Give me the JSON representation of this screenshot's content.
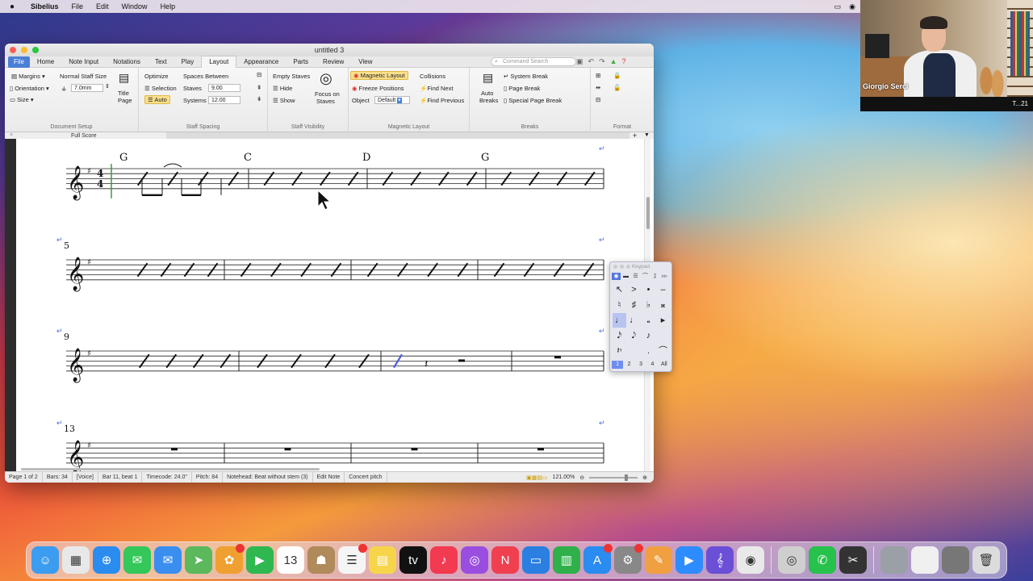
{
  "menubar": {
    "app": "Sibelius",
    "items": [
      "File",
      "Edit",
      "Window",
      "Help"
    ]
  },
  "window": {
    "title": "untitled 3"
  },
  "tabs": [
    "File",
    "Home",
    "Note Input",
    "Notations",
    "Text",
    "Play",
    "Layout",
    "Appearance",
    "Parts",
    "Review",
    "View"
  ],
  "active_tab": "Layout",
  "search_placeholder": "Command Search",
  "ribbon": {
    "doc_setup": {
      "margins": "Margins",
      "staff_size_label": "Normal Staff Size",
      "orientation": "Orientation",
      "staff_size_value": "7.0mm",
      "size": "Size",
      "title_page_1": "Title",
      "title_page_2": "Page",
      "group_label": "Document Setup"
    },
    "staff_spacing": {
      "optimize": "Optimize",
      "spaces_between": "Spaces Between",
      "selection": "Selection",
      "staves": "Staves",
      "staves_value": "9.00",
      "auto": "Auto",
      "systems": "Systems",
      "systems_value": "12.00",
      "group_label": "Staff Spacing"
    },
    "staff_visibility": {
      "empty_staves": "Empty Staves",
      "hide": "Hide",
      "show": "Show",
      "focus_1": "Focus on",
      "focus_2": "Staves",
      "group_label": "Staff Visibility"
    },
    "magnetic_layout": {
      "magnetic": "Magnetic Layout",
      "collisions": "Collisions",
      "freeze": "Freeze Positions",
      "find_next": "Find Next",
      "object": "Object",
      "object_value": "Default",
      "find_previous": "Find Previous",
      "group_label": "Magnetic Layout"
    },
    "breaks": {
      "auto_1": "Auto",
      "auto_2": "Breaks",
      "system_break": "System Break",
      "page_break": "Page Break",
      "special_page_break": "Special Page Break",
      "group_label": "Breaks"
    },
    "format": {
      "group_label": "Format"
    }
  },
  "subbar": {
    "full_score": "Full Score"
  },
  "score": {
    "systems": [
      {
        "bar_number": "",
        "chords": [
          "G",
          "C",
          "D",
          "G"
        ]
      },
      {
        "bar_number": "5"
      },
      {
        "bar_number": "9"
      },
      {
        "bar_number": "13"
      }
    ]
  },
  "status": {
    "page": "Page 1 of 2",
    "bars": "Bars: 34",
    "voice": "[Voice]",
    "position": "Bar 11, beat 1",
    "timecode": "Timecode: 24.0\"",
    "pitch": "Pitch: 84",
    "notehead": "Notehead: Beat without stem (3)",
    "mode": "Edit Note",
    "concert": "Concert pitch",
    "zoom": "121.00%"
  },
  "keypad": {
    "title": "Keypad",
    "modes": [
      "◉",
      "▬",
      "☰",
      "⌒",
      "⁒",
      "▹▹"
    ],
    "keys": [
      "↖",
      ">",
      "•",
      "–",
      "♮",
      "♯",
      "♭",
      "𝄪",
      "♩",
      "♩",
      "𝅝",
      "▸",
      "𝅘𝅥𝅯",
      "𝅘𝅥𝅮",
      "♪",
      " ",
      "𝄽𝄾",
      " ",
      ".",
      "⌒"
    ],
    "layouts": [
      "1",
      "2",
      "3",
      "4",
      "All"
    ]
  },
  "webcam": {
    "name": "Giorgio Serci",
    "strip_text": "T...21"
  },
  "dock": {
    "apps": [
      {
        "name": "finder",
        "color": "#3b9cf0",
        "glyph": "☺"
      },
      {
        "name": "launchpad",
        "color": "#e8e8e8",
        "glyph": "▦"
      },
      {
        "name": "safari",
        "color": "#2b8cf0",
        "glyph": "⊕"
      },
      {
        "name": "messages",
        "color": "#34c759",
        "glyph": "✉"
      },
      {
        "name": "mail",
        "color": "#3a8ef0",
        "glyph": "✉"
      },
      {
        "name": "maps",
        "color": "#5cb85c",
        "glyph": "➤"
      },
      {
        "name": "photos",
        "color": "#f0a030",
        "glyph": "✿"
      },
      {
        "name": "facetime",
        "color": "#2fb84f",
        "glyph": "▶"
      },
      {
        "name": "calendar",
        "color": "#ffffff",
        "glyph": "13"
      },
      {
        "name": "contacts",
        "color": "#b08a5a",
        "glyph": "☗"
      },
      {
        "name": "reminders",
        "color": "#f5f5f5",
        "glyph": "☰"
      },
      {
        "name": "notes",
        "color": "#f7d54a",
        "glyph": "▤"
      },
      {
        "name": "appletv",
        "color": "#111111",
        "glyph": "tv"
      },
      {
        "name": "music",
        "color": "#f23a50",
        "glyph": "♪"
      },
      {
        "name": "podcasts",
        "color": "#9a4ee0",
        "glyph": "◎"
      },
      {
        "name": "news",
        "color": "#f04050",
        "glyph": "N"
      },
      {
        "name": "keynote",
        "color": "#2a7fe0",
        "glyph": "▭"
      },
      {
        "name": "numbers",
        "color": "#2fb04a",
        "glyph": "▥"
      },
      {
        "name": "appstore",
        "color": "#2a8cf0",
        "glyph": "A"
      },
      {
        "name": "systempreferences",
        "color": "#888888",
        "glyph": "⚙"
      },
      {
        "name": "pages",
        "color": "#f0a040",
        "glyph": "✎"
      },
      {
        "name": "zoom",
        "color": "#2d8cff",
        "glyph": "▶"
      },
      {
        "name": "sibelius",
        "color": "#6b4fd6",
        "glyph": "𝄞"
      },
      {
        "name": "chrome",
        "color": "#e9e9e9",
        "glyph": "◉"
      },
      {
        "name": "sep"
      },
      {
        "name": "screenshot",
        "color": "#cfcfcf",
        "glyph": "◎"
      },
      {
        "name": "whatsapp",
        "color": "#27c24c",
        "glyph": "✆"
      },
      {
        "name": "finalcut",
        "color": "#333333",
        "glyph": "✂"
      },
      {
        "name": "sep"
      },
      {
        "name": "window1",
        "color": "#9aa0a6",
        "glyph": " "
      },
      {
        "name": "window2",
        "color": "#f0f0f0",
        "glyph": " "
      },
      {
        "name": "window3",
        "color": "#777777",
        "glyph": " "
      },
      {
        "name": "trash",
        "color": "#dcdcdc",
        "glyph": "🗑"
      }
    ]
  }
}
